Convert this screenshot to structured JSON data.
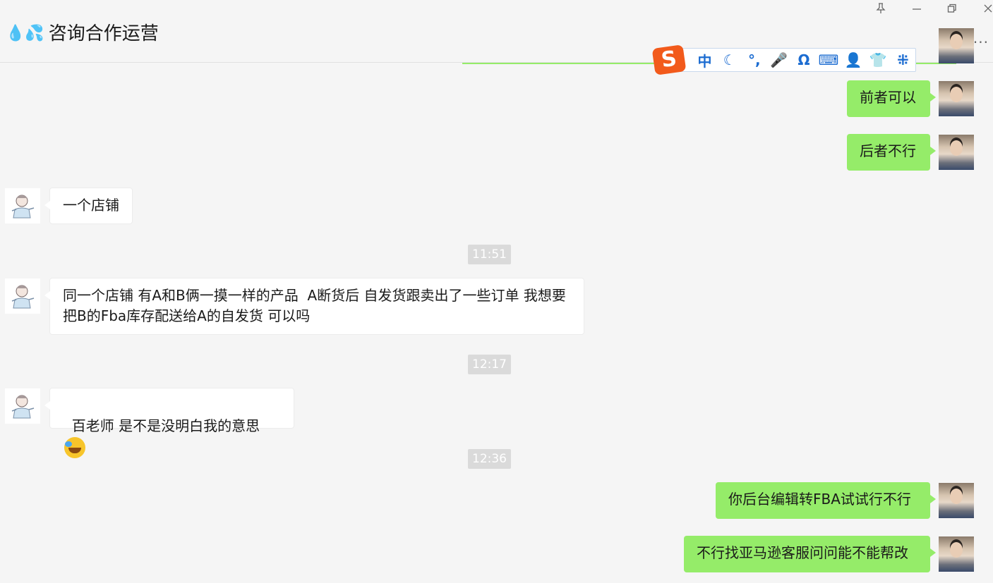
{
  "header": {
    "title_emoji": "💧💦",
    "title": "咨询合作运营",
    "pin_icon": "pin-icon",
    "minimize_icon": "minimize-icon",
    "restore_icon": "restore-icon",
    "close_icon": "close-icon",
    "more": "···"
  },
  "ime_toolbar": {
    "logo": "S",
    "items": [
      "中",
      "☾",
      "°,",
      "🎤",
      "Ω",
      "⌨",
      "👤",
      "👕",
      "⁜"
    ]
  },
  "messages": [
    {
      "side": "me",
      "text": "前者可以"
    },
    {
      "side": "me",
      "text": "后者不行"
    },
    {
      "side": "other",
      "text": "一个店铺"
    },
    {
      "time": "11:51"
    },
    {
      "side": "other",
      "text": "同一个店铺 有A和B俩一摸一样的产品  A断货后 自发货跟卖出了一些订单 我想要把B的Fba库存配送给A的自发货 可以吗"
    },
    {
      "time": "12:17"
    },
    {
      "side": "other",
      "text": "百老师 是不是没明白我的意思",
      "emoji": "face-with-tears-of-joy"
    },
    {
      "time": "12:36"
    },
    {
      "side": "me",
      "text": "你后台编辑转FBA试试行不行"
    },
    {
      "side": "me",
      "text": "不行找亚马逊客服问问能不能帮改"
    }
  ],
  "colors": {
    "background": "#f5f5f5",
    "my_bubble": "#95ec69",
    "other_bubble": "#ffffff",
    "timestamp_bg": "#dadada",
    "ime_accent": "#1c6cd1",
    "ime_logo": "#f25a1b"
  }
}
